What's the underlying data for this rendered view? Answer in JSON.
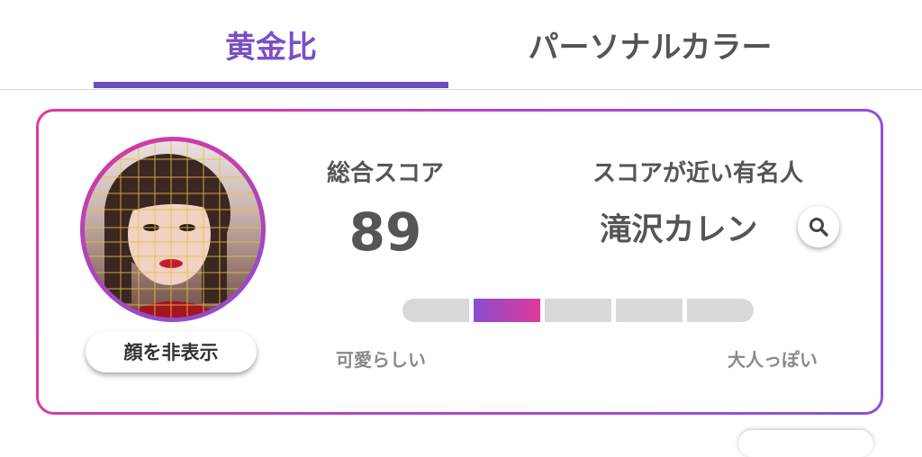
{
  "tabs": [
    {
      "label": "黄金比",
      "active": true
    },
    {
      "label": "パーソナルカラー",
      "active": false
    }
  ],
  "colors": {
    "accent": "#6a4fc4",
    "gradient_start": "#8a4ed0",
    "gradient_end": "#e0399a",
    "text": "#555555",
    "muted": "#8a8a8a"
  },
  "card": {
    "hide_face_button": "顔を非表示",
    "score_label": "総合スコア",
    "score_value": "89",
    "celebrity_label": "スコアが近い有名人",
    "celebrity_name": "滝沢カレン",
    "search_icon": "search-icon",
    "scale": {
      "segments": 5,
      "active_index": 1,
      "left_label": "可愛らしい",
      "right_label": "大人っぽい"
    }
  }
}
